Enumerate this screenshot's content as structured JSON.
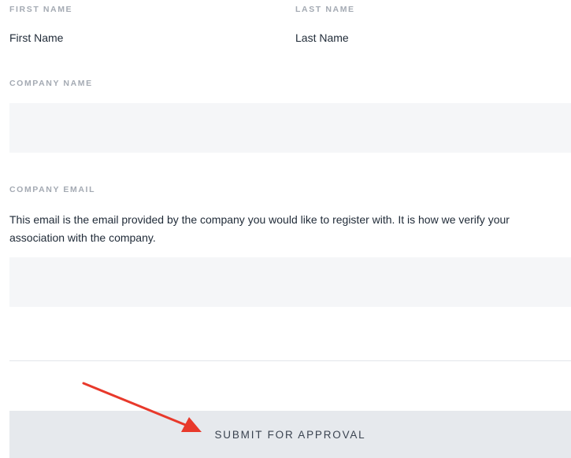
{
  "form": {
    "first_name": {
      "label": "FIRST NAME",
      "value": "First Name"
    },
    "last_name": {
      "label": "LAST NAME",
      "value": "Last Name"
    },
    "company_name": {
      "label": "COMPANY NAME",
      "value": ""
    },
    "company_email": {
      "label": "COMPANY EMAIL",
      "help": "This email is the email provided by the company you would like to register with. It is how we verify your association with the company.",
      "value": ""
    },
    "submit_label": "SUBMIT FOR APPROVAL"
  },
  "annotation": {
    "arrow_color": "#e8392b",
    "icon": "arrow-icon"
  },
  "colors": {
    "field_background": "#f5f6f8",
    "button_background": "#e6e9ed",
    "label_color": "#a4aab3"
  }
}
